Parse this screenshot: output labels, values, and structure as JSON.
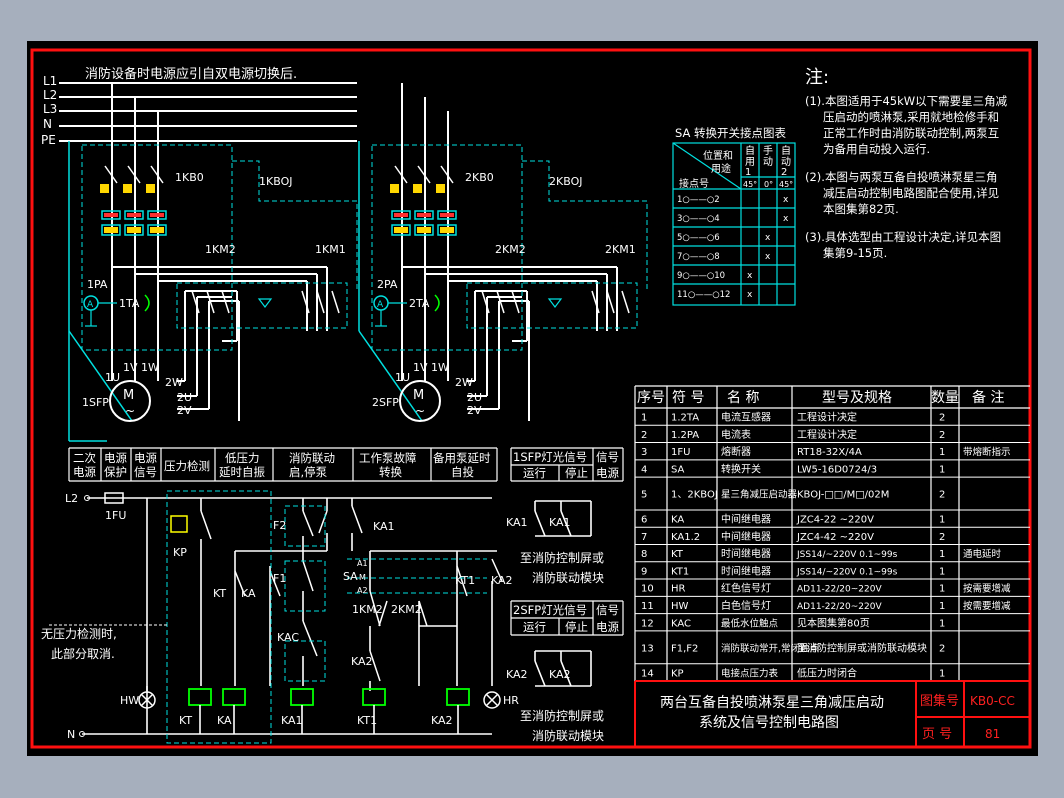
{
  "colors": {
    "frame": "#ff1010",
    "wire": "#00e0e0",
    "power": "#ffffff",
    "dashed": "#00e0e0",
    "text": "#ffffff",
    "cyanText": "#00e0e0",
    "titleText": "#ff2020",
    "breaker": "#ffd700",
    "relayRed": "#ff3030",
    "background": "#000000",
    "viewport": "#a6afbd"
  },
  "notes": {
    "heading": "注:",
    "items": [
      "(1).本图适用于45kW以下需要星三角减",
      "压启动的喷淋泵,采用就地检修手和",
      "正常工作时由消防联动控制,两泵互",
      "为备用自动投入运行.",
      "(2).本图与两泵互备自投喷淋泵星三角",
      "减压启动控制电路图配合使用,详见",
      "本图集第82页.",
      "(3).具体选型由工程设计决定,详见本图",
      "集第9-15页."
    ]
  },
  "top_note": "消防设备时电源应引自双电源切换后.",
  "bus_labels": [
    "L1",
    "L2",
    "L3",
    "N",
    "PE"
  ],
  "power_labels": {
    "pump1": {
      "breaker": "1KB0",
      "kboj": "1KBOJ",
      "km2": "1KM2",
      "km1": "1KM1",
      "pa": "1PA",
      "ta": "1TA",
      "u1": "1U",
      "v1": "1V",
      "w1": "1W",
      "w2": "2W",
      "u2": "2U",
      "v2": "2V",
      "motor": "M",
      "sfp": "1SFP"
    },
    "pump2": {
      "breaker": "2KB0",
      "kboj": "2KBOJ",
      "km2": "2KM2",
      "km1": "2KM1",
      "pa": "2PA",
      "ta": "2TA",
      "u1": "1U",
      "v1": "1V",
      "w1": "1W",
      "w2": "2W",
      "u2": "2U",
      "v2": "2V",
      "motor": "M",
      "sfp": "2SFP"
    }
  },
  "sa_table": {
    "title": "SA 转换开关接点图表",
    "header": {
      "diag_top": "位置和",
      "diag_mid": "用途",
      "diag_bottom": "接点号",
      "cols": [
        "自",
        "手",
        "自"
      ],
      "cols2": [
        "用",
        "动",
        "动"
      ],
      "cols3": [
        "1",
        "",
        "2"
      ],
      "angles": [
        "45°",
        "0°",
        "45°"
      ]
    },
    "rows": [
      {
        "contacts": "1○——○2",
        "marks": [
          "",
          "",
          "x"
        ]
      },
      {
        "contacts": "3○——○4",
        "marks": [
          "",
          "",
          "x"
        ]
      },
      {
        "contacts": "5○——○6",
        "marks": [
          "",
          "x",
          ""
        ]
      },
      {
        "contacts": "7○——○8",
        "marks": [
          "",
          "x",
          ""
        ]
      },
      {
        "contacts": "9○——○10",
        "marks": [
          "x",
          "",
          ""
        ]
      },
      {
        "contacts": "11○——○12",
        "marks": [
          "x",
          "",
          ""
        ]
      }
    ]
  },
  "bom": {
    "headers": [
      "序号",
      "符 号",
      "名  称",
      "型号及规格",
      "数量",
      "备 注"
    ],
    "rows": [
      [
        "1",
        "1.2TA",
        "电流互感器",
        "工程设计决定",
        "2",
        ""
      ],
      [
        "2",
        "1.2PA",
        "电流表",
        "工程设计决定",
        "2",
        ""
      ],
      [
        "3",
        "1FU",
        "熔断器",
        "RT18-32X/4A",
        "1",
        "带熔断指示"
      ],
      [
        "4",
        "SA",
        "转换开关",
        "LW5-16D0724/3",
        "1",
        ""
      ],
      [
        "5",
        "1、2KBOJ",
        "星三角减压启动器",
        "KBOJ-□□/M□/02M",
        "2",
        ""
      ],
      [
        "6",
        "KA",
        "中间继电器",
        "JZC4-22 ~220V",
        "1",
        ""
      ],
      [
        "7",
        "KA1.2",
        "中间继电器",
        "JZC4-42 ~220V",
        "2",
        ""
      ],
      [
        "8",
        "KT",
        "时间继电器",
        "JSS14/~220V 0.1~99s",
        "1",
        "通电延时"
      ],
      [
        "9",
        "KT1",
        "时间继电器",
        "JSS14/~220V 0.1~99s",
        "1",
        ""
      ],
      [
        "10",
        "HR",
        "红色信号灯",
        "AD11-22/20~220V",
        "1",
        "按需要增减"
      ],
      [
        "11",
        "HW",
        "白色信号灯",
        "AD11-22/20~220V",
        "1",
        "按需要增减"
      ],
      [
        "12",
        "KAC",
        "最低水位触点",
        "见本图集第80页",
        "1",
        ""
      ],
      [
        "13",
        "F1,F2",
        "消防联动常开,常闭触点",
        "至消防控制屏或消防联动模块",
        "2",
        ""
      ],
      [
        "14",
        "KP",
        "电接点压力表",
        "低压力时闭合",
        "1",
        ""
      ]
    ]
  },
  "title_block": {
    "title_line1": "两台互备自投喷淋泵星三角减压启动",
    "title_line2": "系统及信号控制电路图",
    "atlas_label": "图集号",
    "atlas_value": "KB0-CC",
    "page_label": "页  号",
    "page_value": "81"
  },
  "control": {
    "header_cells": [
      [
        "二次",
        "电源"
      ],
      [
        "电源",
        "保护"
      ],
      [
        "电源",
        "信号"
      ],
      [
        "压力检测",
        ""
      ],
      [
        "低压力",
        "延时自振"
      ],
      [
        "消防联动",
        "启,停泵"
      ],
      [
        "工作泵故障",
        "转换"
      ],
      [
        "备用泵延时",
        "自投"
      ]
    ],
    "sfp1_header": [
      "1SFP灯光信号",
      "运行",
      "停止",
      "信号",
      "电源"
    ],
    "sfp2_header": [
      "2SFP灯光信号",
      "运行",
      "停止",
      "信号",
      "电源"
    ],
    "labels": {
      "l2": "L2",
      "n": "N",
      "fu": "1FU",
      "kp": "KP",
      "kt": "KT",
      "ka": "KA",
      "f1": "F1",
      "f2": "F2",
      "kac": "KAC",
      "ka1": "KA1",
      "ka2": "KA2",
      "kt1": "KT1",
      "sa": "SA",
      "a1": "A1",
      "m": "M",
      "a2": "A2",
      "km2a": "1KM2",
      "km2b": "2KM2",
      "hw": "HW",
      "hr": "HR"
    },
    "no_pressure_note": [
      "无压力检测时,",
      "此部分取消."
    ],
    "module_text": [
      "至消防控制屏或",
      "消防联动模块"
    ]
  }
}
